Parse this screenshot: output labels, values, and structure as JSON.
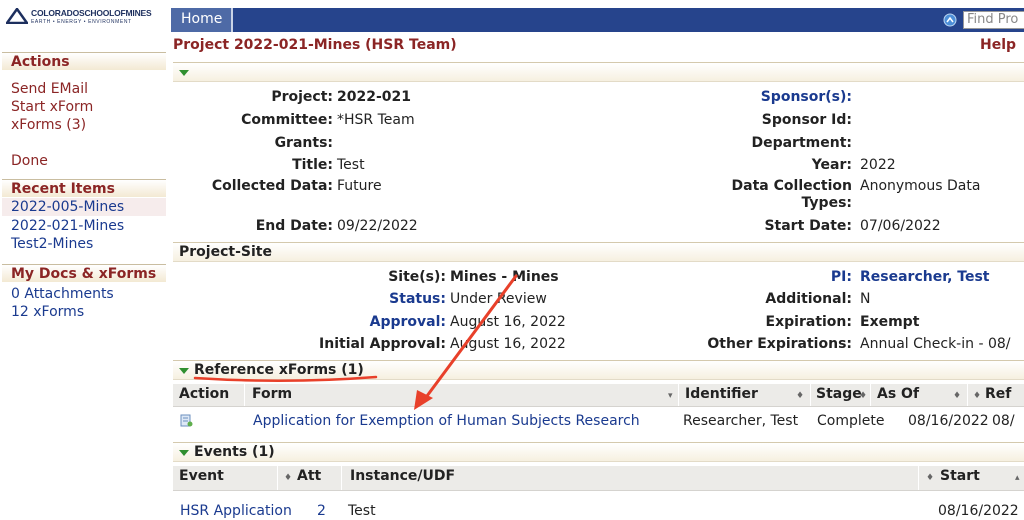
{
  "logo": {
    "line1": "COLORADOSCHOOLOFMINES",
    "line2": "EARTH • ENERGY • ENVIRONMENT"
  },
  "sidebar": {
    "actions_header": "Actions",
    "actions": [
      "Send EMail",
      "Start xForm",
      "xForms (3)"
    ],
    "done": "Done",
    "recent_header": "Recent Items",
    "recent": [
      "2022-005-Mines",
      "2022-021-Mines",
      "Test2-Mines"
    ],
    "docs_header": "My Docs & xForms",
    "docs": [
      "0 Attachments",
      "12 xForms"
    ]
  },
  "topbar": {
    "home": "Home",
    "find_placeholder": "Find Pro"
  },
  "page": {
    "title": "Project 2022-021-Mines (HSR Team)",
    "help": "Help"
  },
  "project": {
    "left": [
      {
        "label": "Project:",
        "value": "2022-021"
      },
      {
        "label": "Committee:",
        "value": "*HSR Team"
      },
      {
        "label": "Grants:",
        "value": ""
      },
      {
        "label": "Title:",
        "value": "Test"
      },
      {
        "label": "Collected Data:",
        "value": "Future"
      },
      {
        "label": "End Date:",
        "value": "09/22/2022"
      }
    ],
    "right": [
      {
        "label": "Sponsor(s):",
        "value": ""
      },
      {
        "label": "Sponsor Id:",
        "value": ""
      },
      {
        "label": "Department:",
        "value": ""
      },
      {
        "label": "Year:",
        "value": "2022"
      },
      {
        "label": "Data Collection",
        "label2": "Types:",
        "value": "Anonymous Data"
      },
      {
        "label": "Start Date:",
        "value": "07/06/2022"
      }
    ]
  },
  "site": {
    "header": "Project-Site",
    "left": [
      {
        "label": "Site(s):",
        "value": "Mines - Mines"
      },
      {
        "label": "Status:",
        "value": "Under Review"
      },
      {
        "label": "Approval:",
        "value": "August 16, 2022"
      },
      {
        "label": "Initial Approval:",
        "value": "August 16, 2022"
      }
    ],
    "right": [
      {
        "label": "PI:",
        "value": "Researcher, Test"
      },
      {
        "label": "Additional:",
        "value": "N"
      },
      {
        "label": "Expiration:",
        "value": "Exempt"
      },
      {
        "label": "Other Expirations:",
        "value": "Annual Check-in - 08/"
      }
    ]
  },
  "xforms": {
    "header": "Reference xForms (1)",
    "columns": [
      "Action",
      "Form",
      "Identifier",
      "Stage",
      "As Of",
      "Ref"
    ],
    "rows": [
      {
        "form": "Application for Exemption of Human Subjects Research",
        "identifier": "Researcher, Test",
        "stage": "Complete",
        "as_of": "08/16/2022",
        "ref": "08/"
      }
    ]
  },
  "events": {
    "header": "Events (1)",
    "columns": [
      "Event",
      "Att",
      "Instance/UDF",
      "Start"
    ],
    "rows": [
      {
        "event": "HSR Application",
        "att": "2",
        "instance": "Test",
        "start": "08/16/2022"
      }
    ]
  },
  "colors": {
    "maroon": "#8b2525",
    "navy": "#26448c",
    "link": "#1a3a8f",
    "annotation": "#e8402a"
  }
}
